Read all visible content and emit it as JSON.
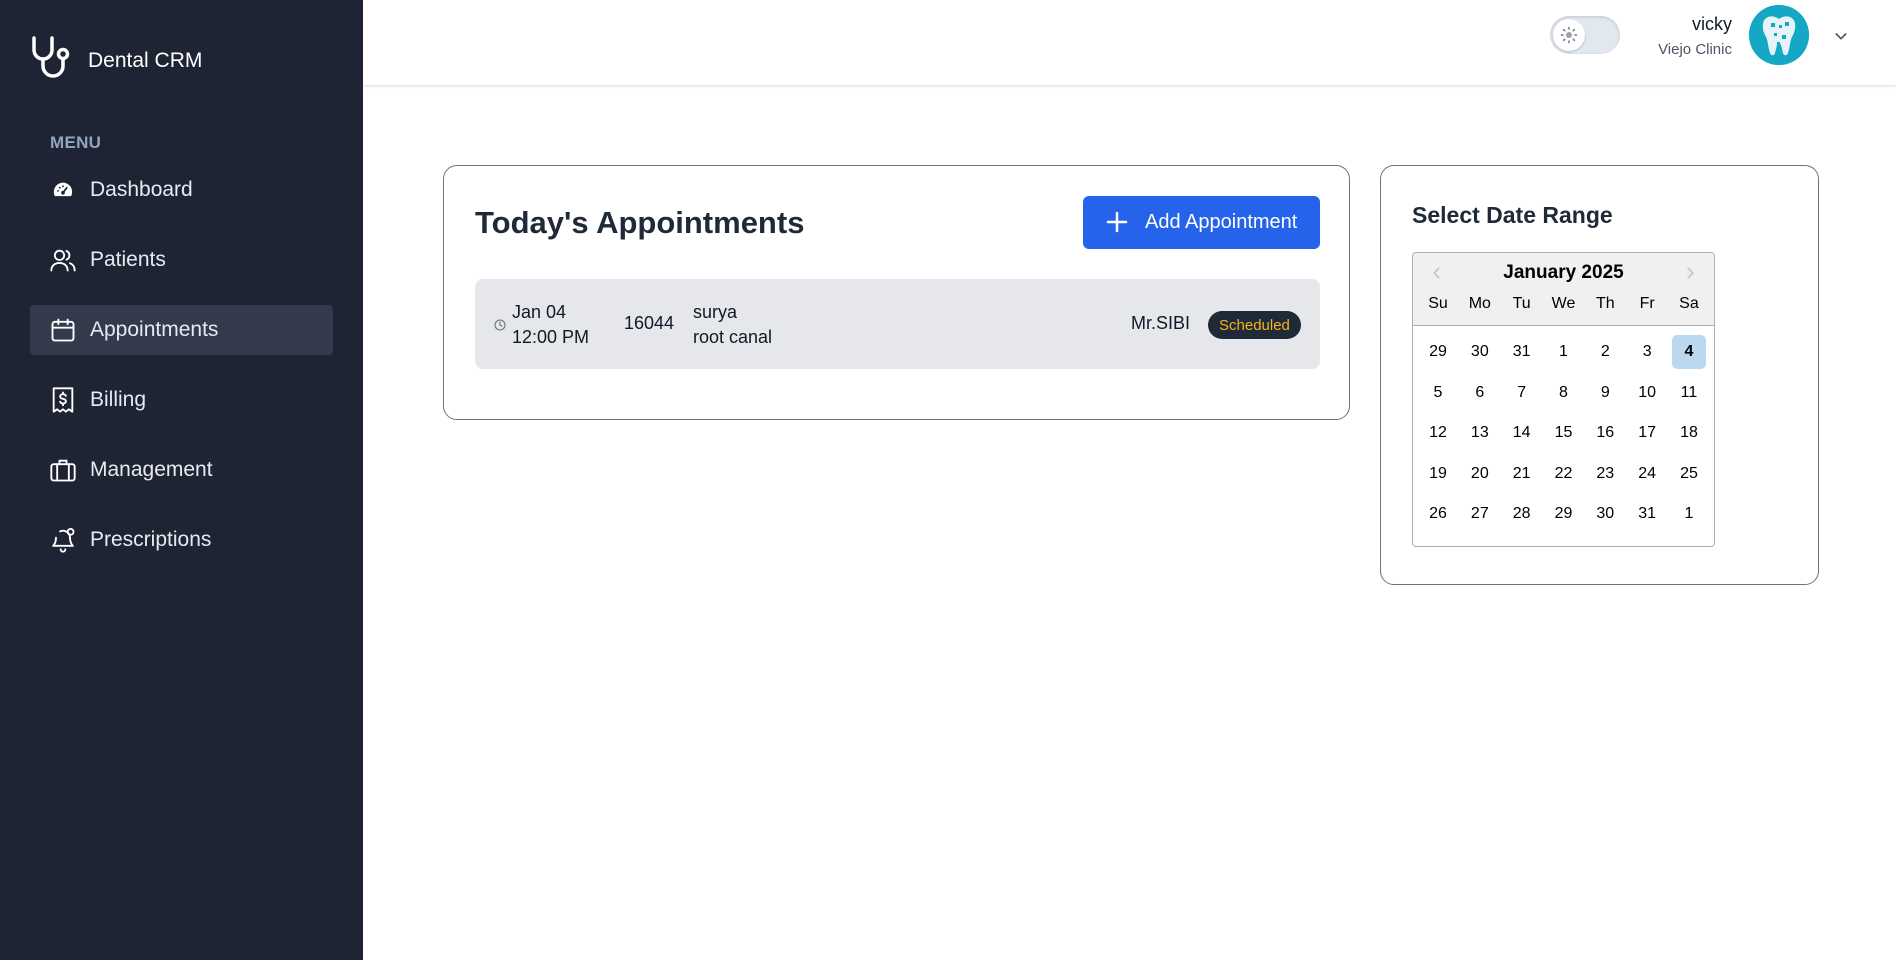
{
  "brand": {
    "name": "Dental CRM",
    "icon": "stethoscope-icon"
  },
  "sidebar": {
    "menu_label": "MENU",
    "items": [
      {
        "label": "Dashboard",
        "icon": "gauge-icon",
        "active": false
      },
      {
        "label": "Patients",
        "icon": "users-icon",
        "active": false
      },
      {
        "label": "Appointments",
        "icon": "calendar-icon",
        "active": true
      },
      {
        "label": "Billing",
        "icon": "receipt-icon",
        "active": false
      },
      {
        "label": "Management",
        "icon": "briefcase-icon",
        "active": false
      },
      {
        "label": "Prescriptions",
        "icon": "bell-icon",
        "active": false
      }
    ]
  },
  "header": {
    "user_name": "vicky",
    "clinic": "Viejo Clinic",
    "theme": "light"
  },
  "appointments": {
    "title": "Today's Appointments",
    "add_label": "Add Appointment",
    "rows": [
      {
        "date": "Jan 04",
        "time": "12:00 PM",
        "id": "16044",
        "patient": "surya",
        "treatment": "root canal",
        "doctor": "Mr.SIBI",
        "status": "Scheduled"
      }
    ]
  },
  "date_range": {
    "title": "Select Date Range",
    "month": "January 2025",
    "weekdays": [
      "Su",
      "Mo",
      "Tu",
      "We",
      "Th",
      "Fr",
      "Sa"
    ],
    "weeks": [
      [
        "29",
        "30",
        "31",
        "1",
        "2",
        "3",
        "4"
      ],
      [
        "5",
        "6",
        "7",
        "8",
        "9",
        "10",
        "11"
      ],
      [
        "12",
        "13",
        "14",
        "15",
        "16",
        "17",
        "18"
      ],
      [
        "19",
        "20",
        "21",
        "22",
        "23",
        "24",
        "25"
      ],
      [
        "26",
        "27",
        "28",
        "29",
        "30",
        "31",
        "1"
      ]
    ],
    "selected": "4"
  },
  "colors": {
    "sidebar_bg": "#1e2433",
    "active_item_bg": "#333a4b",
    "primary": "#2563eb",
    "status_badge_bg": "#1f2937",
    "status_badge_text": "#f6b51a",
    "selected_day": "#bad9f1"
  }
}
